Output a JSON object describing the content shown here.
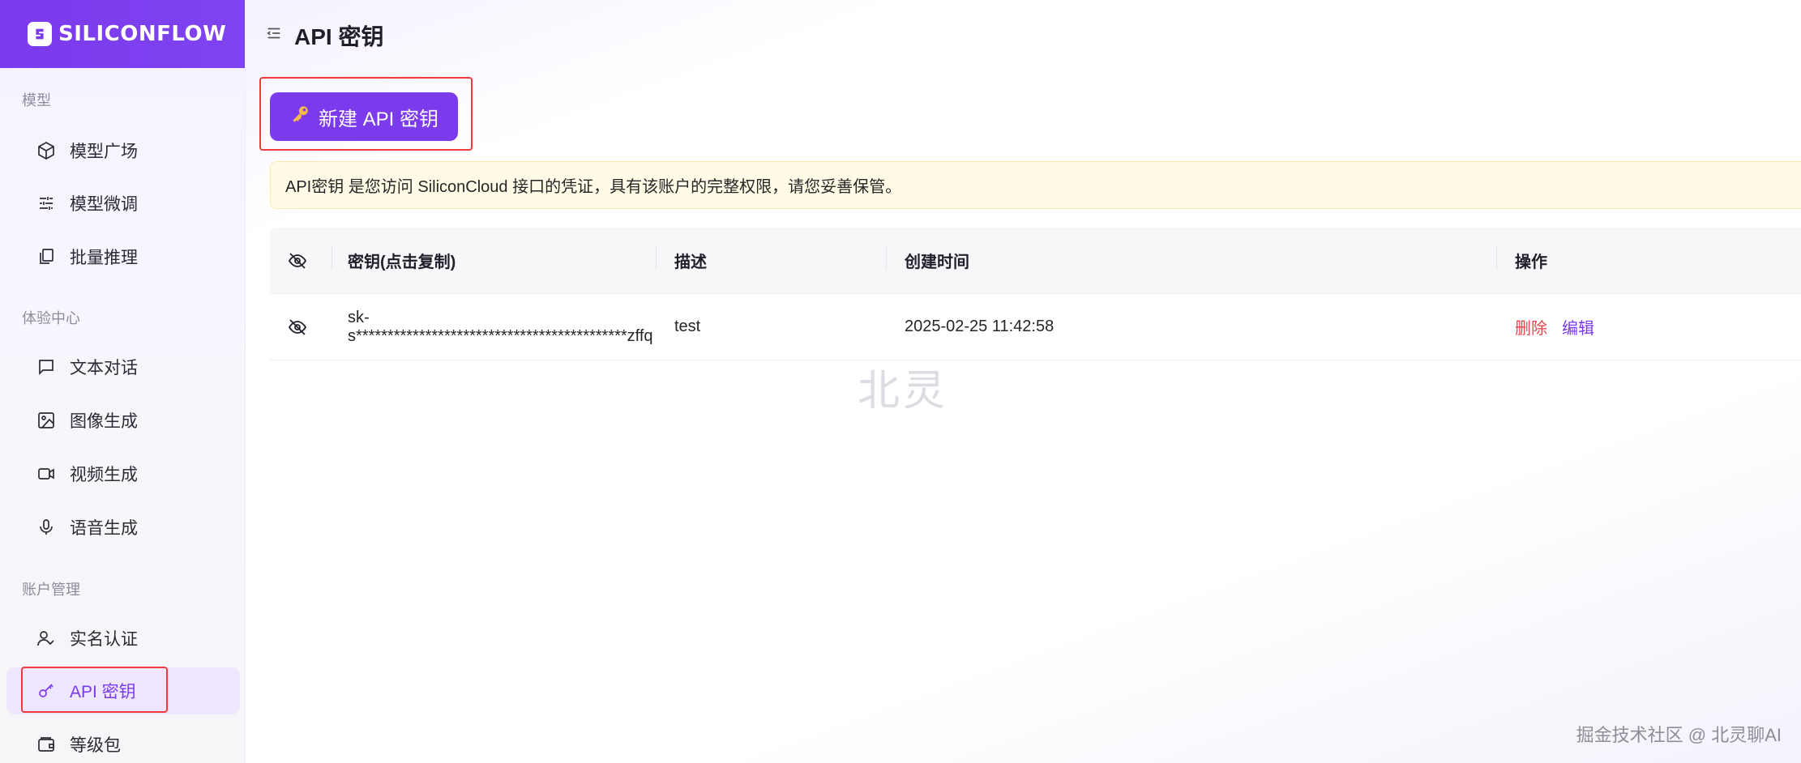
{
  "brand": {
    "name": "SILICONFLOW"
  },
  "header": {
    "title": "API 密钥"
  },
  "sidebar": {
    "sections": [
      {
        "label": "模型",
        "items": [
          {
            "label": "模型广场",
            "icon": "cube-icon"
          },
          {
            "label": "模型微调",
            "icon": "sliders-icon"
          },
          {
            "label": "批量推理",
            "icon": "copy-icon"
          }
        ]
      },
      {
        "label": "体验中心",
        "items": [
          {
            "label": "文本对话",
            "icon": "chat-icon"
          },
          {
            "label": "图像生成",
            "icon": "image-icon"
          },
          {
            "label": "视频生成",
            "icon": "video-icon"
          },
          {
            "label": "语音生成",
            "icon": "mic-icon"
          }
        ]
      },
      {
        "label": "账户管理",
        "items": [
          {
            "label": "实名认证",
            "icon": "user-check-icon"
          },
          {
            "label": "API 密钥",
            "icon": "key-icon",
            "active": true
          },
          {
            "label": "等级包",
            "icon": "wallet-icon"
          }
        ]
      }
    ]
  },
  "toolbar": {
    "new_key_label": "新建 API 密钥"
  },
  "notice": {
    "text": "API密钥 是您访问 SiliconCloud 接口的凭证，具有该账户的完整权限，请您妥善保管。"
  },
  "table": {
    "columns": [
      "密钥(点击复制)",
      "描述",
      "创建时间",
      "操作"
    ],
    "rows": [
      {
        "key": "sk-s*******************************************zffq",
        "description": "test",
        "created": "2025-02-25 11:42:58",
        "actions": {
          "delete": "删除",
          "edit": "编辑"
        }
      }
    ]
  },
  "watermark": "北灵",
  "footer": {
    "credit": "掘金技术社区 @ 北灵聊AI"
  },
  "colors": {
    "accent": "#7c3aed",
    "danger": "#e0474a",
    "notice_bg": "#fffbe6",
    "highlight": "#ef3b3b"
  }
}
